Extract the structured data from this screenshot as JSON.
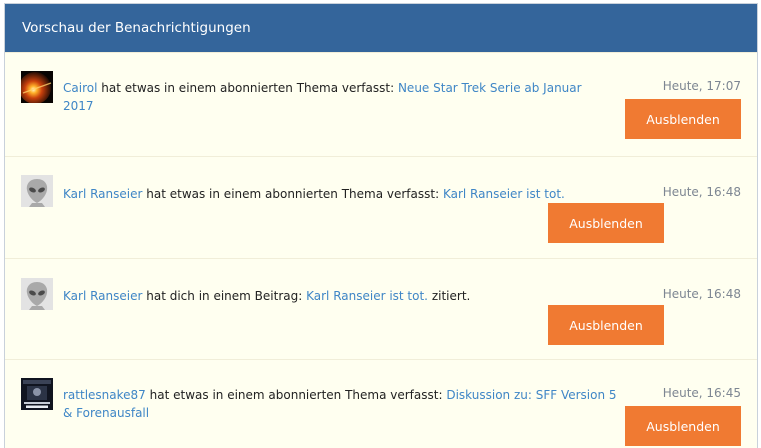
{
  "header": {
    "title": "Vorschau der Benachrichtigungen"
  },
  "notifications": [
    {
      "user": "Cairol",
      "action": "hat etwas in einem abonnierten Thema verfasst:",
      "link": "Neue Star Trek Serie ab Januar 2017",
      "suffix": "",
      "time": "Heute, 17:07",
      "button": "Ausblenden",
      "avatar": "flare-image"
    },
    {
      "user": "Karl Ranseier",
      "action": "hat etwas in einem abonnierten Thema verfasst:",
      "link": "Karl Ranseier ist tot.",
      "suffix": "",
      "time": "Heute, 16:48",
      "button": "Ausblenden",
      "avatar": "alien-placeholder"
    },
    {
      "user": "Karl Ranseier",
      "action": "hat dich in einem Beitrag:",
      "link": "Karl Ranseier ist tot.",
      "suffix": "zitiert.",
      "time": "Heute, 16:48",
      "button": "Ausblenden",
      "avatar": "alien-placeholder"
    },
    {
      "user": "rattlesnake87",
      "action": "hat etwas in einem abonnierten Thema verfasst:",
      "link": "Diskussion zu: SFF Version 5 & Forenausfall",
      "suffix": "",
      "time": "Heute, 16:45",
      "button": "Ausblenden",
      "avatar": "star-trek-poster"
    }
  ],
  "colors": {
    "header_bg": "#34659b",
    "panel_bg": "#fffff0",
    "link": "#3f86c6",
    "button": "#f07a32",
    "time": "#7d8692"
  }
}
